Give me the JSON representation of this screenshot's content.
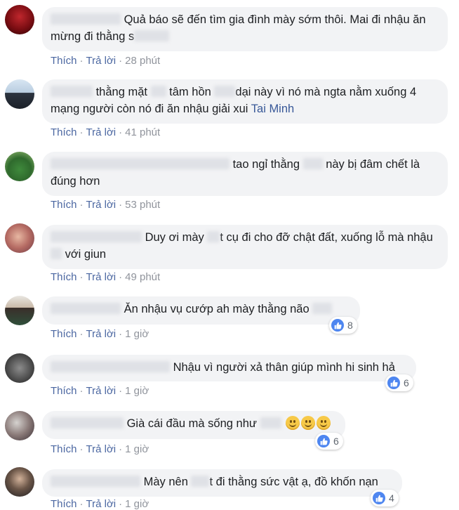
{
  "actions": {
    "like": "Thích",
    "reply": "Trả lời",
    "sep": "·"
  },
  "comments": [
    {
      "text": "Quả báo sẽ đến tìm gia đình mày sớm thôi. Mai đi nhậu ăn mừng đi thằng s",
      "time": "28 phút"
    },
    {
      "text1": "thằng mặt",
      "text2": "tâm hồn",
      "text3": "dại này vì nó mà ngta nằm xuống 4 mạng người còn nó đi ăn nhậu giải xui",
      "tag": "Tai Minh",
      "time": "41 phút"
    },
    {
      "text1": "tao ngỉ thằng",
      "text2": "này bị đâm chết là đúng hơn",
      "time": "53 phút"
    },
    {
      "text1": "Duy ơi mày",
      "text2": "t cụ đi cho đỡ chật đất, xuống lỗ mà nhậu",
      "text3": "với giun",
      "time": "49 phút"
    },
    {
      "text": "Ăn nhậu vụ cướp ah mày thằng não",
      "time": "1 giờ",
      "reactions": "8"
    },
    {
      "text": "Nhậu vì người xả thân giúp mình hi sinh hả",
      "time": "1 giờ",
      "reactions": "6"
    },
    {
      "text": "Già cái đầu mà sống như",
      "time": "1 giờ",
      "reactions": "6"
    },
    {
      "text1": "Mày nên",
      "text2": "t đi thằng sức vật ạ, đồ khốn nạn",
      "time": "1 giờ",
      "reactions": "4"
    }
  ],
  "icons": {
    "like": "like-thumb-icon",
    "smile": "smiley-emoji-icon"
  },
  "colors": {
    "bubble": "#f2f3f5",
    "link": "#4b67a1",
    "tag": "#385898",
    "like": "#4e86f0"
  }
}
